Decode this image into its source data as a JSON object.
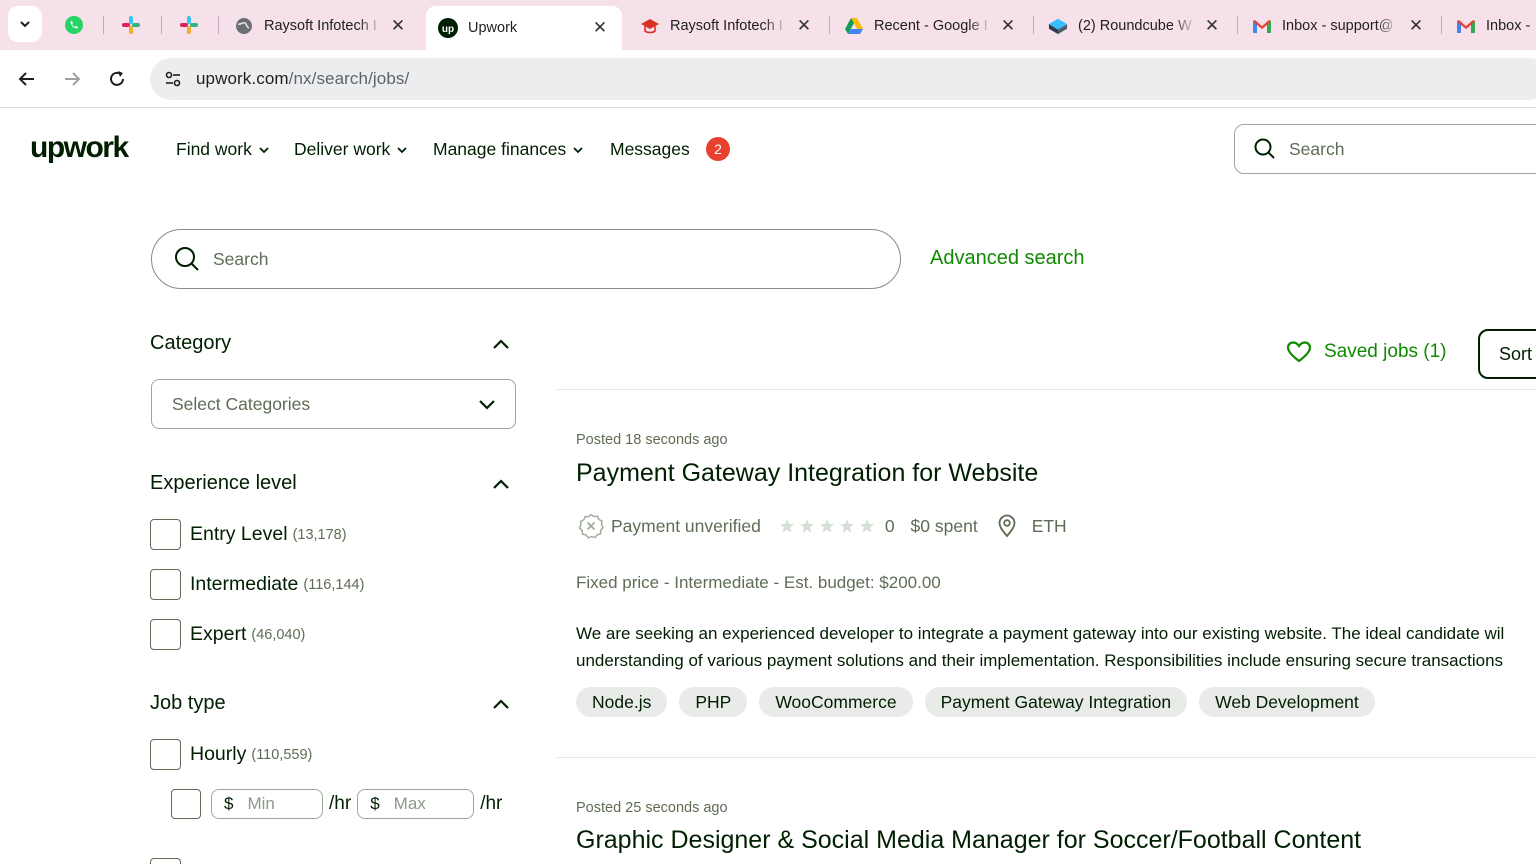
{
  "browser": {
    "tabs": [
      {
        "title": "Raysoft Infotech I",
        "icon": "globe-icon",
        "active": false
      },
      {
        "title": "Upwork",
        "icon": "upwork-favicon",
        "active": true
      },
      {
        "title": "Raysoft Infotech I",
        "icon": "graduation-cap-icon",
        "active": false
      },
      {
        "title": "Recent - Google I",
        "icon": "google-drive-icon",
        "active": false
      },
      {
        "title": "(2) Roundcube W",
        "icon": "roundcube-icon",
        "active": false
      },
      {
        "title": "Inbox - support@",
        "icon": "gmail-icon",
        "active": false
      },
      {
        "title": "Inbox -",
        "icon": "gmail-icon",
        "active": false
      }
    ],
    "pinned": [
      "whatsapp-icon",
      "slack-icon",
      "slack-icon"
    ],
    "url_main": "upwork.com",
    "url_path": "/nx/search/jobs/"
  },
  "header": {
    "logo": "upwork",
    "nav": [
      "Find work",
      "Deliver work",
      "Manage finances",
      "Messages"
    ],
    "messages_badge": "2",
    "search_placeholder": "Search"
  },
  "search": {
    "placeholder": "Search",
    "advanced_label": "Advanced search"
  },
  "filters": {
    "category": {
      "title": "Category",
      "select_label": "Select Categories"
    },
    "experience": {
      "title": "Experience level",
      "options": [
        {
          "label": "Entry Level",
          "count": "(13,178)",
          "checked": false
        },
        {
          "label": "Intermediate",
          "count": "(116,144)",
          "checked": false
        },
        {
          "label": "Expert",
          "count": "(46,040)",
          "checked": false
        }
      ]
    },
    "job_type": {
      "title": "Job type",
      "hourly_label": "Hourly",
      "hourly_count": "(110,559)",
      "currency": "$",
      "min_placeholder": "Min",
      "max_placeholder": "Max",
      "rate_unit": "/hr"
    }
  },
  "results": {
    "saved_jobs_label": "Saved jobs (1)",
    "sort_label": "Sort",
    "jobs": [
      {
        "posted": "Posted 18 seconds ago",
        "title": "Payment Gateway Integration for Website",
        "payment_status": "Payment unverified",
        "rating": 0,
        "rating_text": "0",
        "spent": "$0 spent",
        "location": "ETH",
        "info": "Fixed price - Intermediate - Est. budget: $200.00",
        "description_line1": "We are seeking an experienced developer to integrate a payment gateway into our existing website. The ideal candidate wil",
        "description_line2": "understanding of various payment solutions and their implementation. Responsibilities include ensuring secure transactions",
        "skills": [
          "Node.js",
          "PHP",
          "WooCommerce",
          "Payment Gateway Integration",
          "Web Development"
        ]
      },
      {
        "posted": "Posted 25 seconds ago",
        "title": "Graphic Designer & Social Media Manager for Soccer/Football Content"
      }
    ]
  },
  "colors": {
    "brand_green": "#108a00",
    "text_dark": "#001e00",
    "text_muted": "#5e6d55",
    "badge_red": "#e8402e",
    "tabbar_bg": "#f6e1ea"
  }
}
